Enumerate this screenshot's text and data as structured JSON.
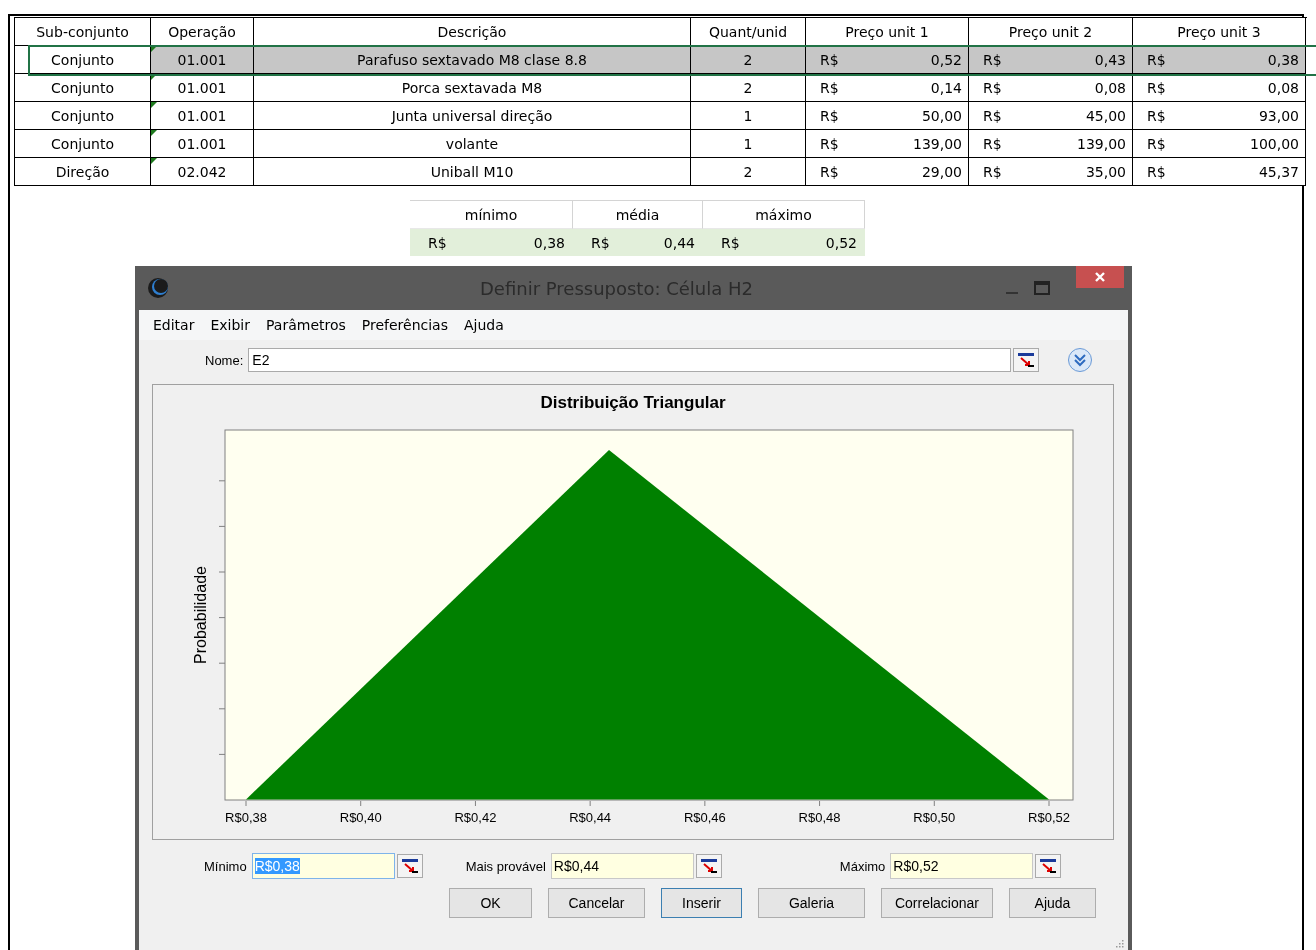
{
  "sheet": {
    "columns": [
      "Sub-conjunto",
      "Operação",
      "Descrição",
      "Quant/unid",
      "Preço unit 1",
      "Preço unit 2",
      "Preço unit 3"
    ],
    "rows": [
      {
        "sub": "Conjunto",
        "op": "01.001",
        "desc": "Parafuso sextavado M8 clase 8.8",
        "qty": "2",
        "prices": [
          {
            "currency": "R$",
            "amount": "0,52"
          },
          {
            "currency": "R$",
            "amount": "0,43"
          },
          {
            "currency": "R$",
            "amount": "0,38"
          }
        ],
        "selected": true,
        "flagged": true
      },
      {
        "sub": "Conjunto",
        "op": "01.001",
        "desc": "Porca sextavada M8",
        "qty": "2",
        "prices": [
          {
            "currency": "R$",
            "amount": "0,14"
          },
          {
            "currency": "R$",
            "amount": "0,08"
          },
          {
            "currency": "R$",
            "amount": "0,08"
          }
        ],
        "selected": false,
        "flagged": true
      },
      {
        "sub": "Conjunto",
        "op": "01.001",
        "desc": "Junta universal direção",
        "qty": "1",
        "prices": [
          {
            "currency": "R$",
            "amount": "50,00"
          },
          {
            "currency": "R$",
            "amount": "45,00"
          },
          {
            "currency": "R$",
            "amount": "93,00"
          }
        ],
        "selected": false,
        "flagged": true
      },
      {
        "sub": "Conjunto",
        "op": "01.001",
        "desc": "volante",
        "qty": "1",
        "prices": [
          {
            "currency": "R$",
            "amount": "139,00"
          },
          {
            "currency": "R$",
            "amount": "139,00"
          },
          {
            "currency": "R$",
            "amount": "100,00"
          }
        ],
        "selected": false,
        "flagged": true
      },
      {
        "sub": "Direção",
        "op": "02.042",
        "desc": "Uniball M10",
        "qty": "2",
        "prices": [
          {
            "currency": "R$",
            "amount": "29,00"
          },
          {
            "currency": "R$",
            "amount": "35,00"
          },
          {
            "currency": "R$",
            "amount": "45,37"
          }
        ],
        "selected": false,
        "flagged": true
      }
    ]
  },
  "summary": {
    "columns": [
      "mínimo",
      "média",
      "máximo"
    ],
    "values": [
      {
        "currency": "R$",
        "amount": "0,38"
      },
      {
        "currency": "R$",
        "amount": "0,44"
      },
      {
        "currency": "R$",
        "amount": "0,52"
      }
    ]
  },
  "dialog": {
    "title": "Definir Pressuposto: Célula H2",
    "menu": [
      "Editar",
      "Exibir",
      "Parâmetros",
      "Preferências",
      "Ajuda"
    ],
    "name": {
      "label": "Nome:",
      "value": "E2"
    },
    "chart": {
      "title": "Distribuição Triangular",
      "y_label": "Probabilidade",
      "x_labels": [
        "R$0,38",
        "R$0,40",
        "R$0,42",
        "R$0,44",
        "R$0,46",
        "R$0,48",
        "R$0,50",
        "R$0,52"
      ]
    },
    "parameters": [
      {
        "label": "Mínimo",
        "value": "R$0,38",
        "selected": true
      },
      {
        "label": "Mais provável",
        "value": "R$0,44",
        "selected": false
      },
      {
        "label": "Máximo",
        "value": "R$0,52",
        "selected": false
      }
    ],
    "buttons": [
      {
        "label": "OK",
        "focused": false
      },
      {
        "label": "Cancelar",
        "focused": false
      },
      {
        "label": "Inserir",
        "focused": true
      },
      {
        "label": "Galeria",
        "focused": false
      },
      {
        "label": "Correlacionar",
        "focused": false
      },
      {
        "label": "Ajuda",
        "focused": false
      }
    ]
  }
}
